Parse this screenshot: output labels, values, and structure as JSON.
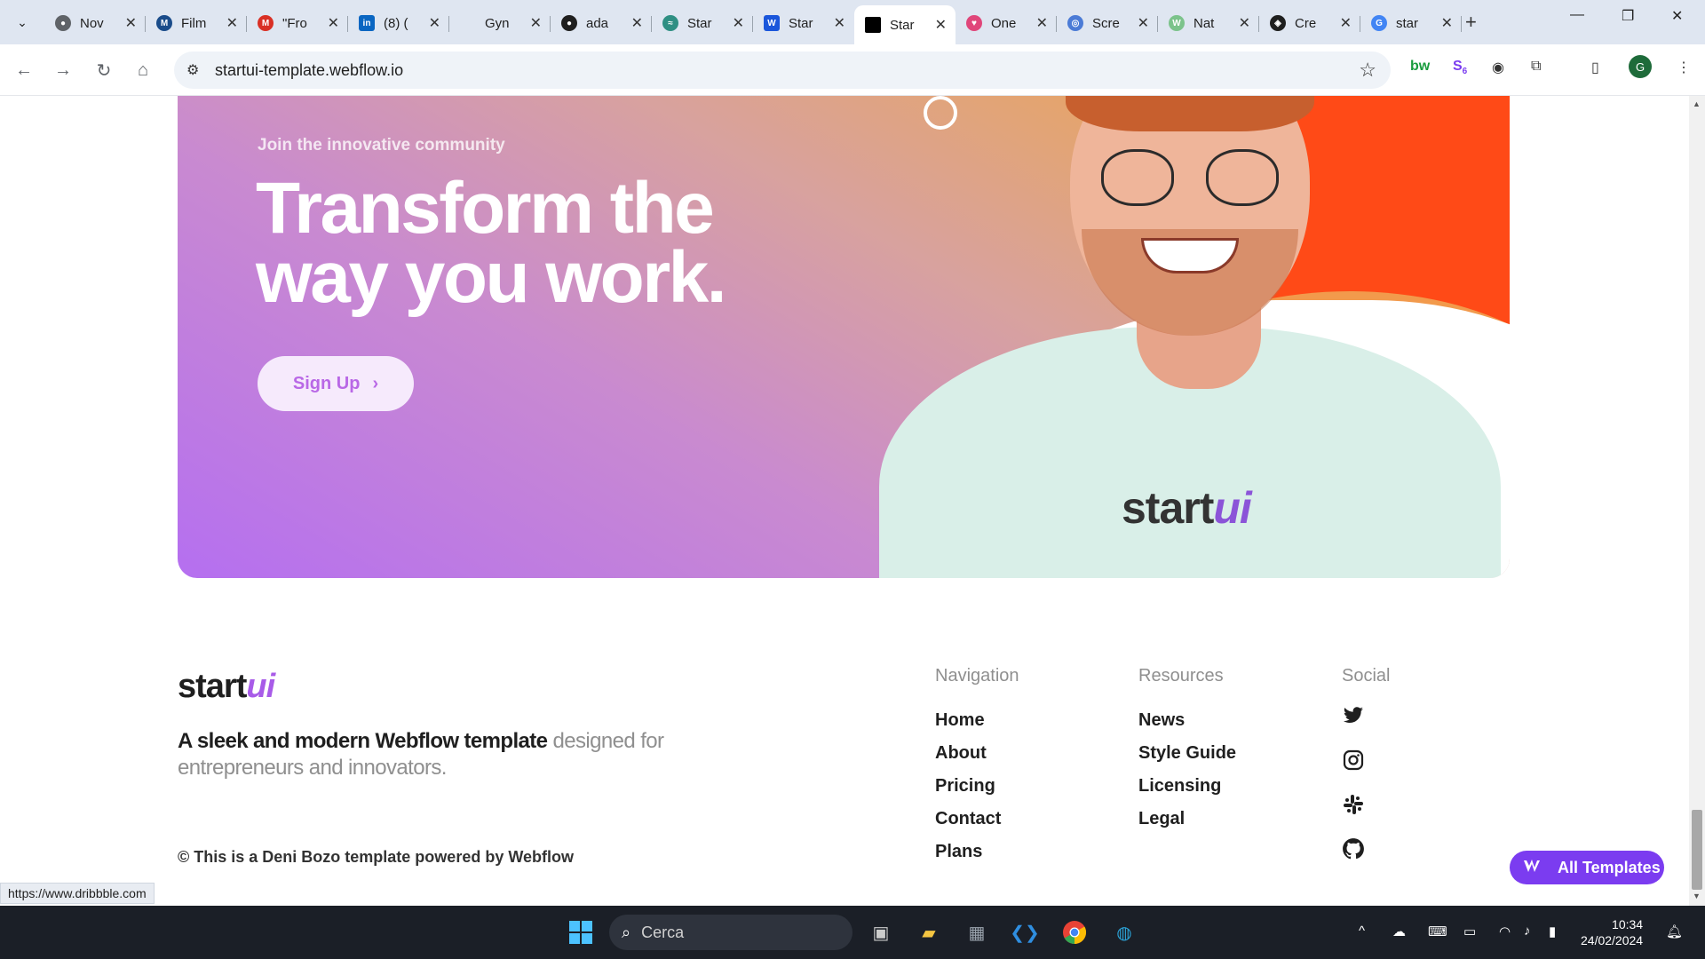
{
  "browser": {
    "tabs": [
      {
        "title": "Nov",
        "fav_color": "#5f6368",
        "fav_char": "●"
      },
      {
        "title": "Film",
        "fav_color": "#1a4c8a",
        "fav_char": "M"
      },
      {
        "title": "\"Fro",
        "fav_color": "#d93025",
        "fav_char": "M"
      },
      {
        "title": "(8) (",
        "fav_color": "#0a66c2",
        "fav_char": "in"
      },
      {
        "title": "Gyn",
        "fav_color": "#e5e7eb",
        "fav_char": ""
      },
      {
        "title": "ada",
        "fav_color": "#1f1f1f",
        "fav_char": "●"
      },
      {
        "title": "Star",
        "fav_color": "#2f8f83",
        "fav_char": "≈"
      },
      {
        "title": "Star",
        "fav_color": "#1a56db",
        "fav_char": "W"
      },
      {
        "title": "Star",
        "fav_color": "#000000",
        "fav_char": ""
      },
      {
        "title": "One",
        "fav_color": "#e0467a",
        "fav_char": "♥"
      },
      {
        "title": "Scre",
        "fav_color": "#4b7bd6",
        "fav_char": "◎"
      },
      {
        "title": "Nat",
        "fav_color": "#7cc38b",
        "fav_char": "W"
      },
      {
        "title": "Cre",
        "fav_color": "#1f1f1f",
        "fav_char": "◈"
      },
      {
        "title": "star",
        "fav_color": "#4285f4",
        "fav_char": "G"
      }
    ],
    "url": "startui-template.webflow.io",
    "profile_initial": "G",
    "ext_badge": "6",
    "status_url": "https://www.dribbble.com"
  },
  "hero": {
    "kicker": "Join the innovative community",
    "title": "Transform the way you work.",
    "button_label": "Sign Up",
    "button_chevron": "›",
    "shirt_logo_start": "start",
    "shirt_logo_ui": "ui"
  },
  "footer": {
    "logo_start": "start",
    "logo_ui": "ui",
    "tagline_dark": "A sleek and modern Webflow template",
    "tagline_muted": "designed for entrepreneurs and innovators.",
    "copyright": "© This is a Deni Bozo template powered by Webflow",
    "navigation": {
      "heading": "Navigation",
      "links": [
        "Home",
        "About",
        "Pricing",
        "Contact",
        "Plans"
      ]
    },
    "resources": {
      "heading": "Resources",
      "links": [
        "News",
        "Style Guide",
        "Licensing",
        "Legal"
      ]
    },
    "social": {
      "heading": "Social",
      "icons": [
        "twitter-icon",
        "instagram-icon",
        "slack-icon",
        "github-icon"
      ]
    },
    "all_templates_label": "All Templates"
  },
  "taskbar": {
    "search_placeholder": "Cerca",
    "time": "10:34",
    "date": "24/02/2024"
  },
  "colors": {
    "brand_purple": "#a85be8",
    "button_text": "#b968e6",
    "all_templates_bg": "#7b3cf0"
  }
}
